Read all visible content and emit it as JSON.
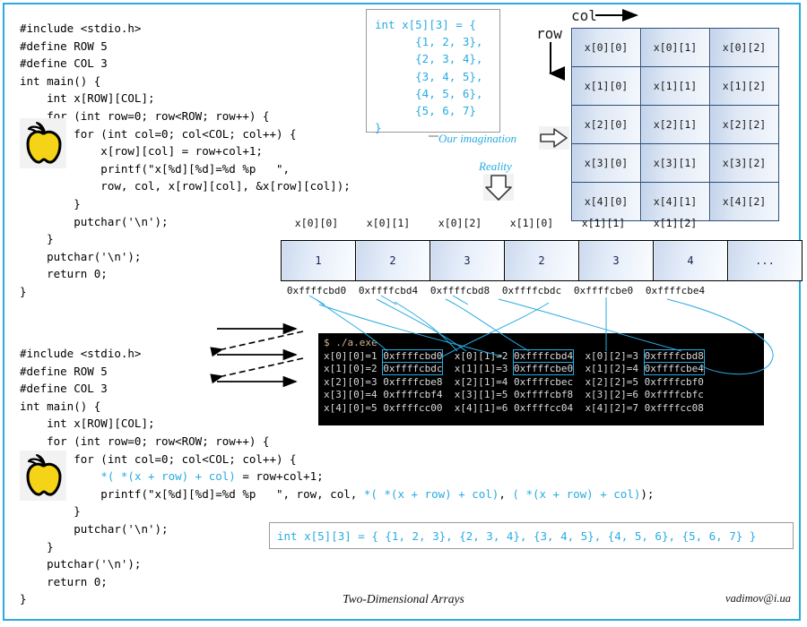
{
  "slide": {
    "title": "Two-Dimensional Arrays",
    "author_email": "vadimov@i.ua",
    "accent_color": "#29abe2",
    "border_color": "#29abe2"
  },
  "code_top": {
    "name": "top-code-sample",
    "lines": [
      "#include <stdio.h>",
      "#define ROW 5",
      "#define COL 3",
      "int main() {",
      "    int x[ROW][COL];",
      "    for (int row=0; row<ROW; row++) {",
      "        for (int col=0; col<COL; col++) {",
      "            x[row][col] = row+col+1;",
      "            printf(\"x[%d][%d]=%d %p   \",",
      "            row, col, x[row][col], &x[row][col]);",
      "        }",
      "        putchar('\\n');",
      "    }",
      "    putchar('\\n');",
      "    return 0;",
      "}"
    ]
  },
  "code_bottom": {
    "name": "bottom-code-sample",
    "lines": [
      "#include <stdio.h>",
      "#define ROW 5",
      "#define COL 3",
      "int main() {",
      "    int x[ROW][COL];",
      "    for (int row=0; row<ROW; row++) {",
      "        for (int col=0; col<COL; col++) {",
      "            *( *(x + row) + col) = row+col+1;",
      "            printf(\"x[%d][%d]=%d %p   \", row, col, *( *(x + row) + col), ( *(x + row) + col));",
      "        }",
      "        putchar('\\n');",
      "    }",
      "    putchar('\\n');",
      "    return 0;",
      "}"
    ],
    "highlight_line_indices": [
      7,
      8
    ]
  },
  "init_box": {
    "name": "array-initializer-box",
    "code": "int x[5][3] = {\n      {1, 2, 3},\n      {2, 3, 4},\n      {3, 4, 5},\n      {4, 5, 6},\n      {5, 6, 7}\n}"
  },
  "grid": {
    "name": "conceptual-2d-grid",
    "col_axis_label": "col",
    "row_axis_label": "row",
    "rows": [
      [
        "x[0][0]",
        "x[0][1]",
        "x[0][2]"
      ],
      [
        "x[1][0]",
        "x[1][1]",
        "x[1][2]"
      ],
      [
        "x[2][0]",
        "x[2][1]",
        "x[2][2]"
      ],
      [
        "x[3][0]",
        "x[3][1]",
        "x[3][2]"
      ],
      [
        "x[4][0]",
        "x[4][1]",
        "x[4][2]"
      ]
    ]
  },
  "annotations": {
    "imagination": "Our imagination",
    "reality": "Reality"
  },
  "linear_array": {
    "name": "memory-linear-array",
    "headers": [
      "x[0][0]",
      "x[0][1]",
      "x[0][2]",
      "x[1][0]",
      "x[1][1]",
      "x[1][2]",
      ""
    ],
    "values": [
      "1",
      "2",
      "3",
      "2",
      "3",
      "4",
      "..."
    ],
    "addresses": [
      "0xffffcbd0",
      "0xffffcbd4",
      "0xffffcbd8",
      "0xffffcbdc",
      "0xffffcbe0",
      "0xffffcbe4",
      ""
    ]
  },
  "terminal": {
    "name": "program-output-terminal",
    "prompt_line": "$ ./a.exe",
    "rows": [
      {
        "cells": [
          {
            "label": "x[0][0]=1",
            "addr": "0xffffcbd0",
            "highlighted": true
          },
          {
            "label": "x[0][1]=2",
            "addr": "0xffffcbd4",
            "highlighted": true
          },
          {
            "label": "x[0][2]=3",
            "addr": "0xffffcbd8",
            "highlighted": true
          }
        ]
      },
      {
        "cells": [
          {
            "label": "x[1][0]=2",
            "addr": "0xffffcbdc",
            "highlighted": true
          },
          {
            "label": "x[1][1]=3",
            "addr": "0xffffcbe0",
            "highlighted": true
          },
          {
            "label": "x[1][2]=4",
            "addr": "0xffffcbe4",
            "highlighted": true
          }
        ]
      },
      {
        "cells": [
          {
            "label": "x[2][0]=3",
            "addr": "0xffffcbe8",
            "highlighted": false
          },
          {
            "label": "x[2][1]=4",
            "addr": "0xffffcbec",
            "highlighted": false
          },
          {
            "label": "x[2][2]=5",
            "addr": "0xffffcbf0",
            "highlighted": false
          }
        ]
      },
      {
        "cells": [
          {
            "label": "x[3][0]=4",
            "addr": "0xffffcbf4",
            "highlighted": false
          },
          {
            "label": "x[3][1]=5",
            "addr": "0xffffcbf8",
            "highlighted": false
          },
          {
            "label": "x[3][2]=6",
            "addr": "0xffffcbfc",
            "highlighted": false
          }
        ]
      },
      {
        "cells": [
          {
            "label": "x[4][0]=5",
            "addr": "0xffffcc00",
            "highlighted": false
          },
          {
            "label": "x[4][1]=6",
            "addr": "0xffffcc04",
            "highlighted": false
          },
          {
            "label": "x[4][2]=7",
            "addr": "0xffffcc08",
            "highlighted": false
          }
        ]
      }
    ]
  },
  "decl_box": {
    "name": "flat-initializer-box",
    "code": "int x[5][3] = { {1, 2, 3}, {2, 3, 4}, {3, 4, 5}, {4, 5, 6}, {5, 6, 7} }"
  },
  "icons": {
    "apple_top": "apple-icon",
    "apple_bottom": "apple-icon",
    "imagination_arrow": "block-arrow-right-icon",
    "reality_arrow": "block-arrow-down-icon",
    "row_axis_arrow": "arrow-down-icon",
    "col_axis_arrow": "arrow-right-icon"
  }
}
